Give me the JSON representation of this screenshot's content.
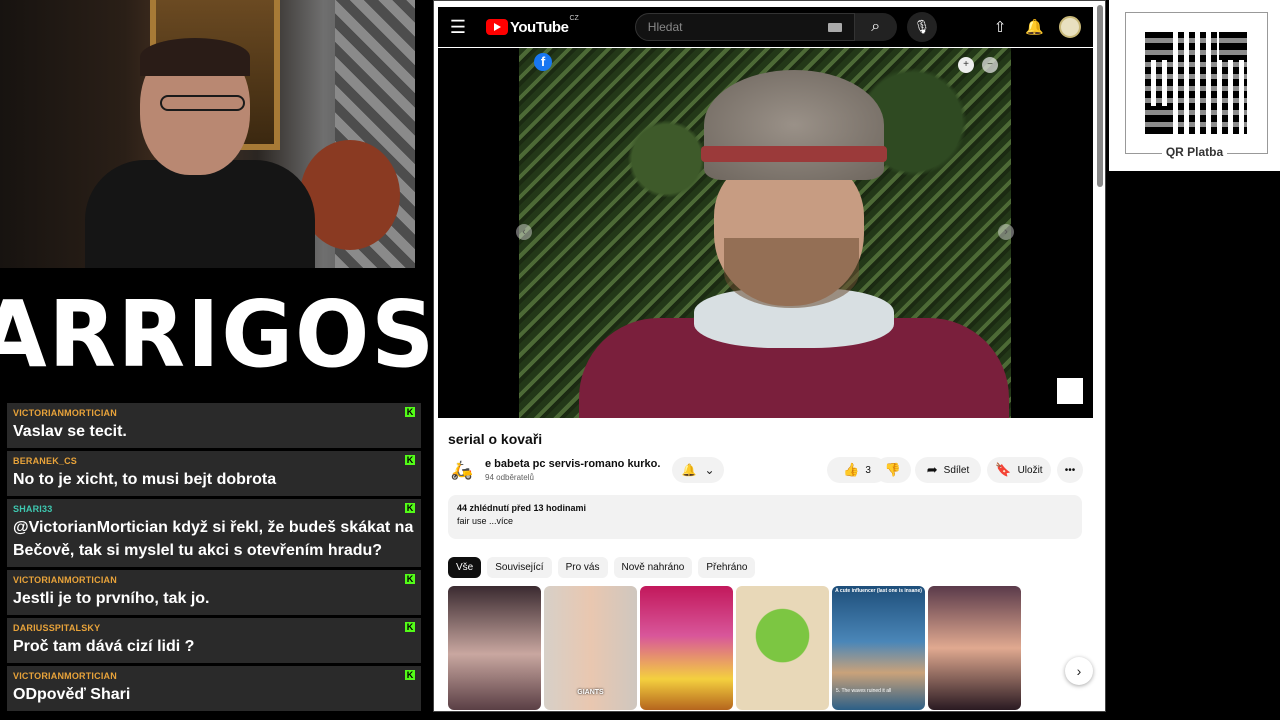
{
  "overlay": {
    "logo_text": "ARRIGOS",
    "qr": {
      "label": "QR Platba"
    }
  },
  "chat": {
    "messages": [
      {
        "user": "VICTORIANMORTICIAN",
        "text": "Vaslav se tecit.",
        "user_color": "#e8a33a"
      },
      {
        "user": "BERANEK_CS",
        "text": "No to je xicht, to musi bejt dobrota",
        "user_color": "#e8a33a"
      },
      {
        "user": "SHARI33",
        "text": "@VictorianMortician když si řekl, že budeš skákat na Bečově, tak si myslel tu akci s otevřením hradu?",
        "user_color": "#3ec8b0"
      },
      {
        "user": "VICTORIANMORTICIAN",
        "text": "Jestli je to prvního, tak jo.",
        "user_color": "#e8a33a"
      },
      {
        "user": "DARIUSSPITALSKY",
        "text": "Proč tam dává cizí lidi ?",
        "user_color": "#e8a33a"
      },
      {
        "user": "VICTORIANMORTICIAN",
        "text": "ODpověď Shari",
        "user_color": "#e8a33a"
      }
    ],
    "badge_icon": "kick-badge-icon",
    "badge_color": "#53fc18"
  },
  "youtube": {
    "brand": "YouTube",
    "country": "CZ",
    "search_placeholder": "Hledat",
    "icons": [
      "menu-icon",
      "search-icon",
      "mic-icon",
      "upload-icon",
      "bell-icon",
      "avatar"
    ],
    "video": {
      "title": "serial o kovaři",
      "channel_name": "e babeta pc servis-romano kurko.",
      "subscribers": "94 odběratelů",
      "likes": "3",
      "share_label": "Sdílet",
      "save_label": "Uložit",
      "stats": "44 zhlédnutí  před 13 hodinami",
      "description": "fair use",
      "more_label": "...více"
    },
    "chips": [
      "Vše",
      "Související",
      "Pro vás",
      "Nově nahráno",
      "Přehráno"
    ],
    "shorts": [
      {
        "top": "",
        "caption": ""
      },
      {
        "top": "",
        "caption": "GIANTS"
      },
      {
        "top": "",
        "caption": ""
      },
      {
        "top": "",
        "caption": ""
      },
      {
        "top": "A cute influencer (last one is insane)",
        "caption": "5. The waves ruined it all"
      },
      {
        "top": "",
        "caption": ""
      }
    ]
  }
}
